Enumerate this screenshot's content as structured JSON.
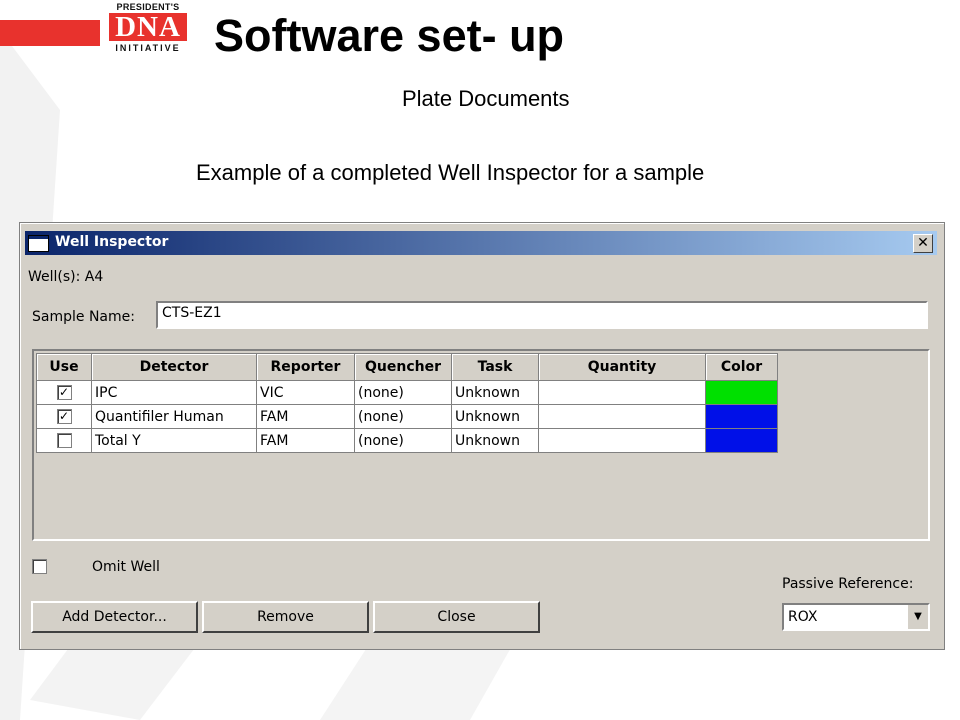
{
  "slide": {
    "title": "Software set- up",
    "subtitle": "Plate Documents",
    "caption": "Example of a completed Well Inspector for a sample",
    "logo": {
      "line1": "PRESIDENT'S",
      "line2": "DNA",
      "line3": "INITIATIVE",
      "accent_color": "#e8322d"
    }
  },
  "dialog": {
    "title": "Well Inspector",
    "close_glyph": "✕",
    "wells_label": "Well(s): A4",
    "sample_name_label": "Sample Name:",
    "sample_name_value": "CTS-EZ1",
    "table": {
      "headers": [
        "Use",
        "Detector",
        "Reporter",
        "Quencher",
        "Task",
        "Quantity",
        "Color"
      ],
      "rows": [
        {
          "use": "✓",
          "detector": "IPC",
          "reporter": "VIC",
          "quencher": "(none)",
          "task": "Unknown",
          "quantity": "",
          "color": "#00e000"
        },
        {
          "use": "✓",
          "detector": "Quantifiler Human",
          "reporter": "FAM",
          "quencher": "(none)",
          "task": "Unknown",
          "quantity": "",
          "color": "#0010e8"
        },
        {
          "use": "",
          "detector": "Total Y",
          "reporter": "FAM",
          "quencher": "(none)",
          "task": "Unknown",
          "quantity": "",
          "color": "#0010e8"
        }
      ]
    },
    "omit_well_label": "Omit Well",
    "buttons": {
      "add_detector": "Add Detector...",
      "remove": "Remove",
      "close": "Close"
    },
    "passive_reference_label": "Passive Reference:",
    "passive_reference_value": "ROX",
    "dropdown_glyph": "▼"
  }
}
